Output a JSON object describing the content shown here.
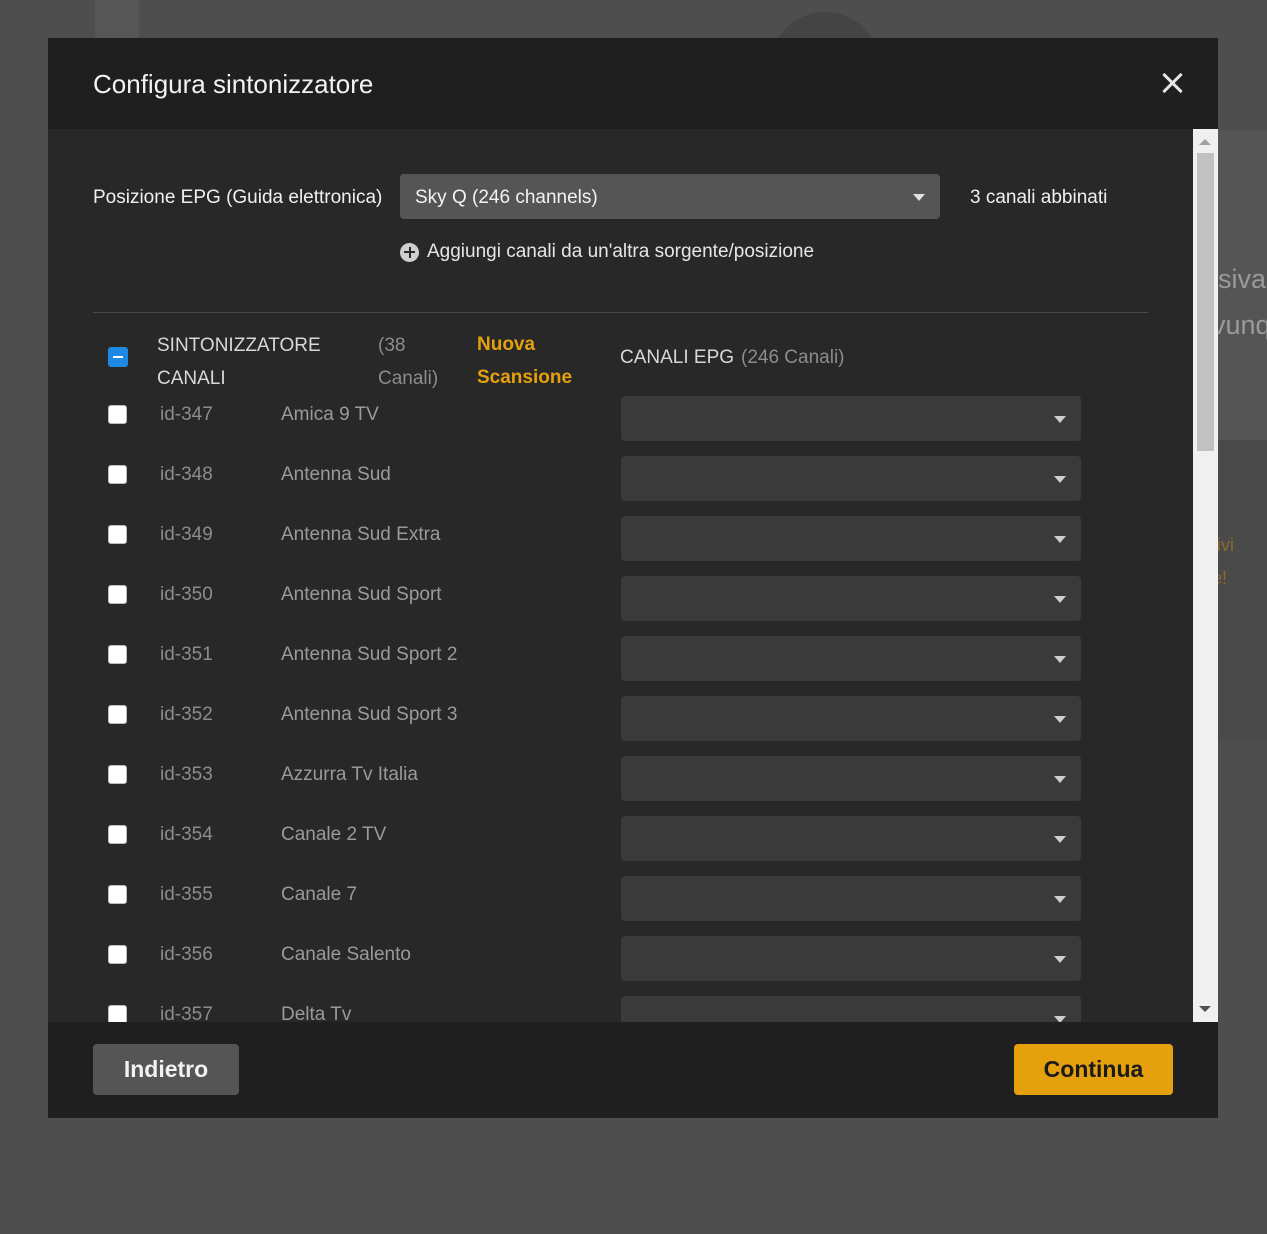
{
  "background": {
    "text_1": "isiva",
    "text_2": "vunq",
    "text_3": "tivi",
    "text_4": "e!"
  },
  "modal": {
    "title": "Configura sintonizzatore"
  },
  "epg": {
    "label": "Posizione EPG (Guida elettronica)",
    "selected": "Sky Q (246 channels)",
    "matched": "3 canali abbinati",
    "add_source": "Aggiungi canali da un'altra sorgente/posizione"
  },
  "table_header": {
    "tuner_label": "SINTONIZZATORE CANALI",
    "tuner_count": "(38 Canali)",
    "rescan": "Nuova Scansione",
    "epg_label": "CANALI EPG",
    "epg_count": "(246 Canali)"
  },
  "rows": [
    {
      "id": "id-347",
      "name": "Amica 9 TV",
      "epg_value": ""
    },
    {
      "id": "id-348",
      "name": "Antenna Sud",
      "epg_value": ""
    },
    {
      "id": "id-349",
      "name": "Antenna Sud Extra",
      "epg_value": ""
    },
    {
      "id": "id-350",
      "name": "Antenna Sud Sport",
      "epg_value": ""
    },
    {
      "id": "id-351",
      "name": "Antenna Sud Sport 2",
      "epg_value": ""
    },
    {
      "id": "id-352",
      "name": "Antenna Sud Sport 3",
      "epg_value": ""
    },
    {
      "id": "id-353",
      "name": "Azzurra Tv Italia",
      "epg_value": ""
    },
    {
      "id": "id-354",
      "name": "Canale 2 TV",
      "epg_value": ""
    },
    {
      "id": "id-355",
      "name": "Canale 7",
      "epg_value": ""
    },
    {
      "id": "id-356",
      "name": "Canale Salento",
      "epg_value": ""
    },
    {
      "id": "id-357",
      "name": "Delta Tv",
      "epg_value": ""
    }
  ],
  "footer": {
    "back_label": "Indietro",
    "continue_label": "Continua"
  },
  "colors": {
    "accent": "#e5a00d",
    "checkbox_checked": "#1e88e5",
    "modal_bg": "#282828"
  }
}
